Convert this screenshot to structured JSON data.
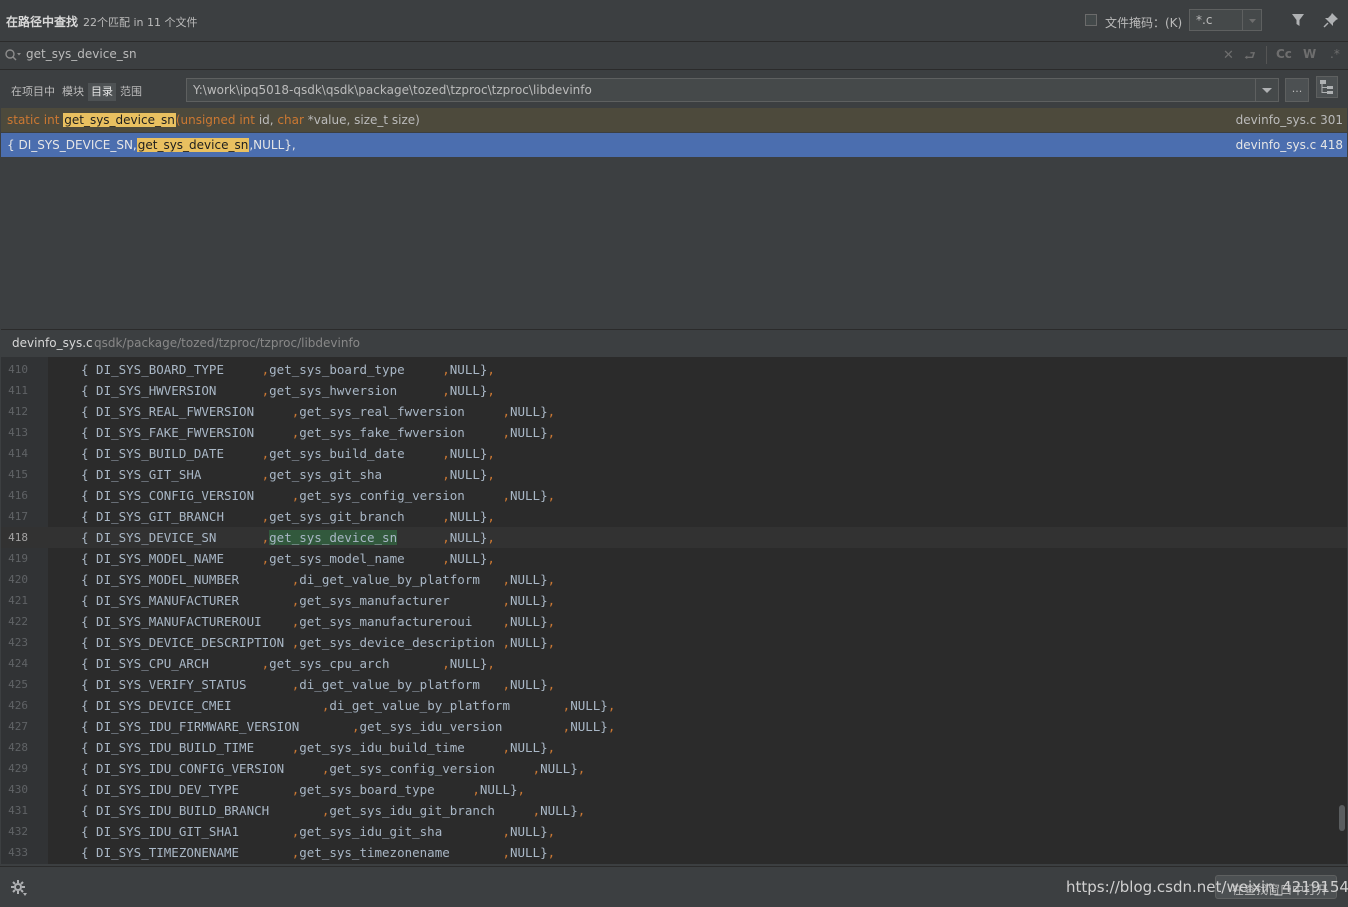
{
  "header": {
    "title": "在路径中查找",
    "subtitle": "22个匹配 in 11 个文件",
    "file_mask_label": "文件掩码：(K)",
    "file_mask_value": "*.c",
    "file_mask_checked": false
  },
  "search": {
    "query": "get_sys_device_sn",
    "toggles": {
      "match_case": "Cc",
      "words": "W"
    }
  },
  "scope": {
    "tabs": [
      {
        "label": "在项目中",
        "active": false
      },
      {
        "label": "模块",
        "active": false
      },
      {
        "label": "目录",
        "active": true
      },
      {
        "label": "范围",
        "active": false
      }
    ],
    "directory": "Y:\\work\\ipq5018-qsdk\\qsdk\\package\\tozed\\tzproc\\tzproc\\libdevinfo",
    "browse_label": "..."
  },
  "results": [
    {
      "kw1": "static int ",
      "match": "get_sys_device_sn",
      "kw2": "(unsigned int ",
      "t1": "id, ",
      "kw3": "char ",
      "t2": "*value, size_t size)",
      "location": "devinfo_sys.c 301",
      "selected": false
    },
    {
      "pre": "{ DI_SYS_DEVICE_SN,",
      "match": "get_sys_device_sn",
      "post": ",NULL},",
      "location": "devinfo_sys.c 418",
      "selected": true
    }
  ],
  "preview": {
    "file": "devinfo_sys.c",
    "path": "qsdk/package/tozed/tzproc/tzproc/libdevinfo",
    "current_line": 418,
    "lines": [
      {
        "num": "410",
        "a": "{ DI_SYS_BOARD_TYPE     ",
        "b": "get_sys_board_type     ",
        "c": "NULL}",
        "col": 1
      },
      {
        "num": "411",
        "a": "{ DI_SYS_HWVERSION      ",
        "b": "get_sys_hwversion      ",
        "c": "NULL}",
        "col": 1
      },
      {
        "num": "412",
        "a": "{ DI_SYS_REAL_FWVERSION     ",
        "b": "get_sys_real_fwversion     ",
        "c": "NULL}",
        "col": 2
      },
      {
        "num": "413",
        "a": "{ DI_SYS_FAKE_FWVERSION     ",
        "b": "get_sys_fake_fwversion     ",
        "c": "NULL}",
        "col": 2
      },
      {
        "num": "414",
        "a": "{ DI_SYS_BUILD_DATE     ",
        "b": "get_sys_build_date     ",
        "c": "NULL}",
        "col": 1
      },
      {
        "num": "415",
        "a": "{ DI_SYS_GIT_SHA        ",
        "b": "get_sys_git_sha        ",
        "c": "NULL}",
        "col": 1
      },
      {
        "num": "416",
        "a": "{ DI_SYS_CONFIG_VERSION     ",
        "b": "get_sys_config_version     ",
        "c": "NULL}",
        "col": 2
      },
      {
        "num": "417",
        "a": "{ DI_SYS_GIT_BRANCH     ",
        "b": "get_sys_git_branch     ",
        "c": "NULL}",
        "col": 1
      },
      {
        "num": "418",
        "a": "{ DI_SYS_DEVICE_SN      ",
        "b": "get_sys_device_sn",
        "b2": "      ",
        "c": "NULL}",
        "col": 1,
        "match": true
      },
      {
        "num": "419",
        "a": "{ DI_SYS_MODEL_NAME     ",
        "b": "get_sys_model_name     ",
        "c": "NULL}",
        "col": 1
      },
      {
        "num": "420",
        "a": "{ DI_SYS_MODEL_NUMBER       ",
        "b": "di_get_value_by_platform   ",
        "c": "NULL}",
        "col": 2
      },
      {
        "num": "421",
        "a": "{ DI_SYS_MANUFACTURER       ",
        "b": "get_sys_manufacturer       ",
        "c": "NULL}",
        "col": 2
      },
      {
        "num": "422",
        "a": "{ DI_SYS_MANUFACTUREROUI    ",
        "b": "get_sys_manufactureroui    ",
        "c": "NULL}",
        "col": 2
      },
      {
        "num": "423",
        "a": "{ DI_SYS_DEVICE_DESCRIPTION ",
        "b": "get_sys_device_description ",
        "c": "NULL}",
        "col": 2
      },
      {
        "num": "424",
        "a": "{ DI_SYS_CPU_ARCH       ",
        "b": "get_sys_cpu_arch       ",
        "c": "NULL}",
        "col": 1
      },
      {
        "num": "425",
        "a": "{ DI_SYS_VERIFY_STATUS      ",
        "b": "di_get_value_by_platform   ",
        "c": "NULL}",
        "col": 2
      },
      {
        "num": "426",
        "a": "{ DI_SYS_DEVICE_CMEI            ",
        "b": "di_get_value_by_platform       ",
        "c": "NULL}",
        "col": 3
      },
      {
        "num": "427",
        "a": "{ DI_SYS_IDU_FIRMWARE_VERSION       ",
        "b": "get_sys_idu_version        ",
        "c": "NULL}",
        "col": 4
      },
      {
        "num": "428",
        "a": "{ DI_SYS_IDU_BUILD_TIME     ",
        "b": "get_sys_idu_build_time     ",
        "c": "NULL}",
        "col": 2
      },
      {
        "num": "429",
        "a": "{ DI_SYS_IDU_CONFIG_VERSION     ",
        "b": "get_sys_config_version     ",
        "c": "NULL}",
        "col": 3
      },
      {
        "num": "430",
        "a": "{ DI_SYS_IDU_DEV_TYPE       ",
        "b": "get_sys_board_type     ",
        "c": "NULL}",
        "col": 2
      },
      {
        "num": "431",
        "a": "{ DI_SYS_IDU_BUILD_BRANCH       ",
        "b": "get_sys_idu_git_branch     ",
        "c": "NULL}",
        "col": 3
      },
      {
        "num": "432",
        "a": "{ DI_SYS_IDU_GIT_SHA1       ",
        "b": "get_sys_idu_git_sha        ",
        "c": "NULL}",
        "col": 2
      },
      {
        "num": "433",
        "a": "{ DI_SYS_TIMEZONENAME       ",
        "b": "get_sys_timezonename       ",
        "c": "NULL}",
        "col": 2
      }
    ]
  },
  "footer": {
    "open_label": "在查找窗口中打开",
    "watermark": "https://blog.csdn.net/weixin_42191545"
  },
  "colors": {
    "keyword": "#cc7832",
    "match_highlight": "#e9c060",
    "selected_row": "#4b6eaf",
    "editor_match": "#32593d"
  }
}
